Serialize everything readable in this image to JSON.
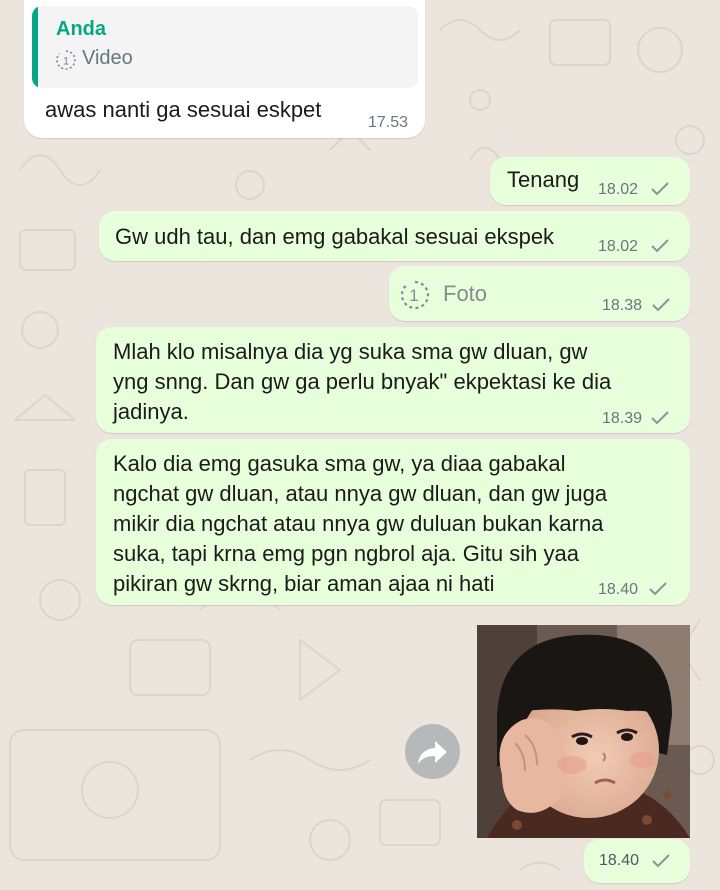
{
  "quoted_message": {
    "author": "Anda",
    "icon": "view-once-icon",
    "type_label": "Video",
    "reply_text": "awas nanti ga sesuai eskpet",
    "time": "17.53"
  },
  "messages": [
    {
      "lines": [
        "Tenang"
      ],
      "time": "18.02",
      "status": "sent-check-icon"
    },
    {
      "lines": [
        "Gw udh tau, dan emg gabakal sesuai ekspek"
      ],
      "time": "18.02",
      "status": "sent-check-icon"
    },
    {
      "view_once_icon": "view-once-icon",
      "label": "Foto",
      "time": "18.38",
      "status": "sent-check-icon"
    },
    {
      "lines": [
        "Mlah klo misalnya dia yg suka sma gw dluan, gw",
        "yng snng. Dan gw ga perlu bnyak\" ekpektasi ke dia",
        "jadinya."
      ],
      "time": "18.39",
      "status": "sent-check-icon"
    },
    {
      "lines": [
        "Kalo dia emg gasuka sma gw, ya diaa gabakal",
        "ngchat gw dluan, atau nnya gw dluan, dan gw juga",
        "mikir dia ngchat atau nnya gw duluan bukan karna",
        "suka, tapi krna emg pgn ngbrol aja. Gitu sih yaa",
        "pikiran gw skrng, biar aman ajaa ni hati"
      ],
      "time": "18.40",
      "status": "sent-check-icon"
    },
    {
      "sticker": "sticker-toddler-resting-cheek-on-hand",
      "forward_icon": "forward-arrow-icon",
      "time": "18.40",
      "status": "sent-check-icon"
    }
  ],
  "colors": {
    "wallpaper": "#ece5dd",
    "outgoing_bubble": "#e7ffdb",
    "incoming_bubble": "#ffffff",
    "accent": "#06a884",
    "meta_text": "#667781"
  }
}
